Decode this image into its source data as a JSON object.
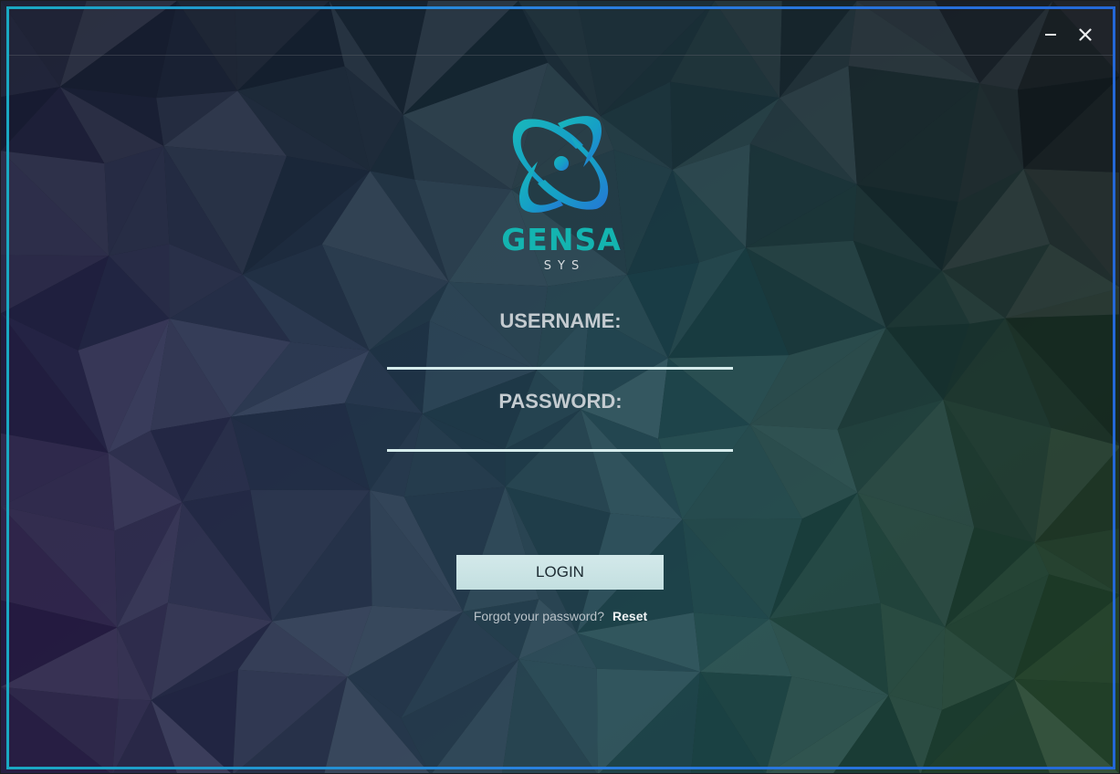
{
  "window": {
    "minimize_label": "–",
    "close_label": "✕"
  },
  "brand": {
    "name": "GENSA",
    "sub": "SYS",
    "logo_icon": "atom-orbit-logo"
  },
  "form": {
    "username_label": "USERNAME:",
    "username_value": "",
    "password_label": "PASSWORD:",
    "password_value": "",
    "login_label": "LOGIN",
    "forgot_text": "Forgot your password?",
    "reset_label": "Reset"
  },
  "colors": {
    "accent_teal": "#14b4b0",
    "accent_blue": "#2a7fe0",
    "frame_border_start": "#1aa9c2",
    "frame_border_end": "#2468d8",
    "button_bg": "#c8e2e3",
    "input_underline": "#d6ecec"
  }
}
